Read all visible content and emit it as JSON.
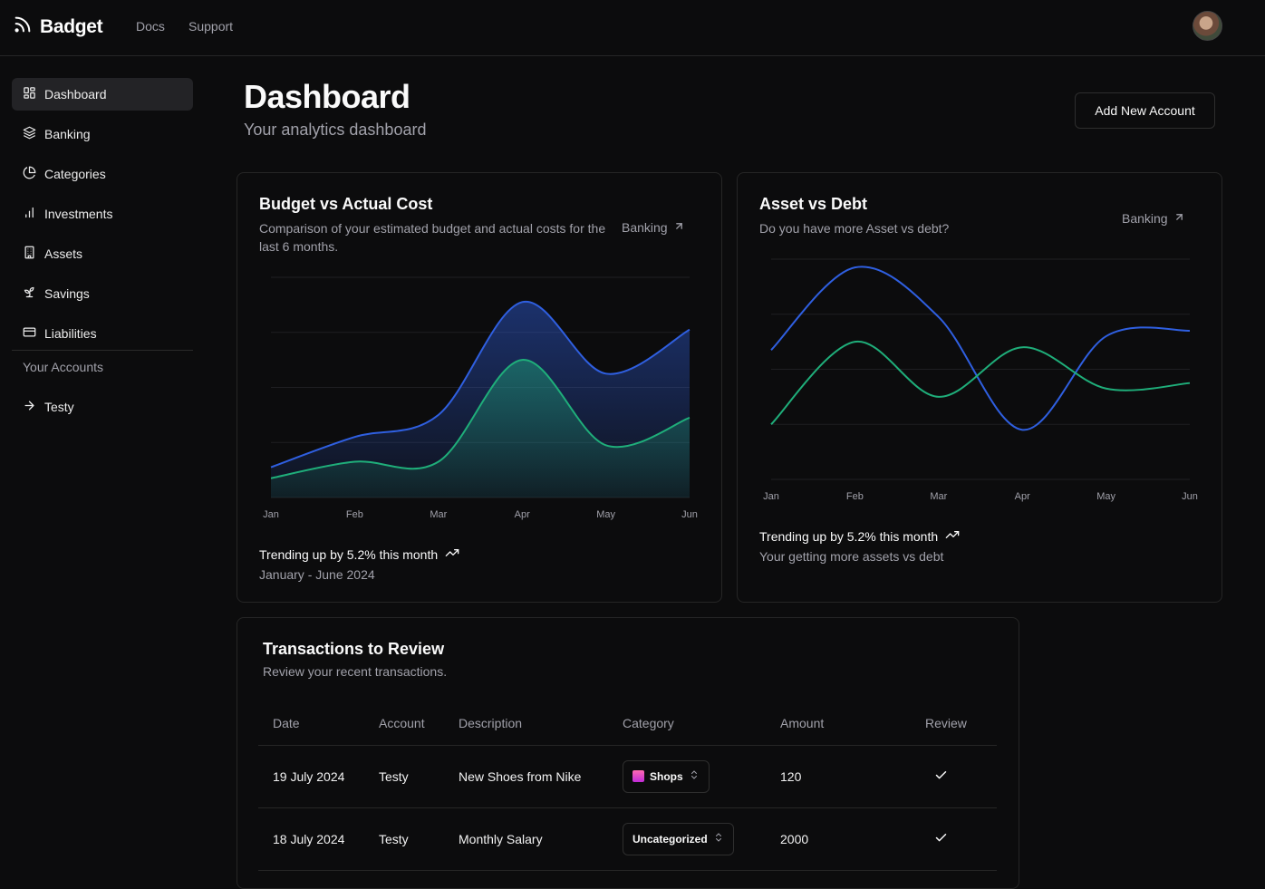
{
  "brand": {
    "name": "Badget"
  },
  "nav": {
    "docs": "Docs",
    "support": "Support"
  },
  "sidebar": {
    "items": [
      {
        "label": "Dashboard",
        "icon": "layout-dashboard-icon",
        "active": true
      },
      {
        "label": "Banking",
        "icon": "layers-icon"
      },
      {
        "label": "Categories",
        "icon": "pie-chart-icon"
      },
      {
        "label": "Investments",
        "icon": "bar-chart-icon"
      },
      {
        "label": "Assets",
        "icon": "building-icon"
      },
      {
        "label": "Savings",
        "icon": "sprout-icon"
      },
      {
        "label": "Liabilities",
        "icon": "credit-card-icon"
      }
    ],
    "accounts_heading": "Your Accounts",
    "accounts": [
      {
        "label": "Testy",
        "icon": "arrow-right-icon"
      }
    ]
  },
  "header": {
    "title": "Dashboard",
    "subtitle": "Your analytics dashboard",
    "add_button": "Add New Account"
  },
  "budget_card": {
    "title": "Budget vs Actual Cost",
    "description": "Comparison of your estimated budget and actual costs for the last 6 months.",
    "link": "Banking",
    "trend": "Trending up by 5.2% this month",
    "period": "January - June 2024"
  },
  "asset_card": {
    "title": "Asset vs Debt",
    "description": "Do you have more Asset vs debt?",
    "link": "Banking",
    "trend": "Trending up by 5.2% this month",
    "note": "Your getting more assets vs debt"
  },
  "transactions": {
    "title": "Transactions to Review",
    "description": "Review your recent transactions.",
    "columns": [
      "Date",
      "Account",
      "Description",
      "Category",
      "Amount",
      "Review"
    ],
    "rows": [
      {
        "date": "19 July 2024",
        "account": "Testy",
        "description": "New Shoes from Nike",
        "category": "Shops",
        "category_icon": "shopping-bags-emoji",
        "amount": "120"
      },
      {
        "date": "18 July 2024",
        "account": "Testy",
        "description": "Monthly Salary",
        "category": "Uncategorized",
        "amount": "2000"
      }
    ]
  },
  "colors": {
    "blue": "#2f5fe0",
    "green": "#1fae7a",
    "background": "#0c0c0d",
    "border": "#262626"
  },
  "chart_data": [
    {
      "type": "area",
      "categories": [
        "Jan",
        "Feb",
        "Mar",
        "Apr",
        "May",
        "Jun"
      ],
      "series": [
        {
          "values": [
            110,
            220,
            300,
            710,
            450,
            610
          ]
        },
        {
          "values": [
            70,
            130,
            130,
            500,
            190,
            290
          ]
        }
      ],
      "ylim": [
        0,
        800
      ],
      "grid": true
    },
    {
      "type": "line",
      "categories": [
        "Jan",
        "Feb",
        "Mar",
        "Apr",
        "May",
        "Jun"
      ],
      "series": [
        {
          "values": [
            470,
            770,
            590,
            180,
            520,
            540
          ]
        },
        {
          "values": [
            200,
            500,
            300,
            480,
            330,
            350
          ]
        }
      ],
      "ylim": [
        0,
        800
      ],
      "grid": true
    }
  ]
}
